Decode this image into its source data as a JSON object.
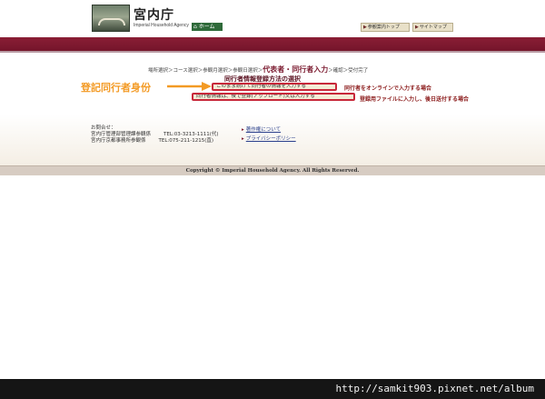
{
  "header": {
    "logo_title": "宮内庁",
    "logo_subtitle": "Imperial Household Agency",
    "home_label": "ホーム",
    "nav_buttons": [
      "参観案内トップ",
      "サイトマップ"
    ]
  },
  "colors": {
    "band": "#7e1a31",
    "accent_red": "#c8283a",
    "annotation_orange": "#f39a24",
    "home_green": "#2f6a3a"
  },
  "steps": {
    "before": "場所選択＞コース選択＞参観月選択＞参観日選択＞",
    "current": "代表者・同行者入力",
    "after": "＞確認＞受付完了"
  },
  "section_title": "同行者情報登録方法の選択",
  "options": [
    {
      "label": "このまま続けて同行者の情報を入力する",
      "description": "同行者をオンラインで入力する場合"
    },
    {
      "label": "同行者情報は、後で登録(アップロード)又は入力する",
      "description": "登録用ファイルに入力し、後日送付する場合"
    }
  ],
  "annotation": {
    "label": "登記同行者身份"
  },
  "contact": {
    "heading": "お問合せ：",
    "rows": [
      {
        "name": "宮内庁管理部管理課参観係",
        "tel": "TEL:03-3213-1111(代)"
      },
      {
        "name": "宮内庁京都事務所参観係",
        "tel": "TEL:075-211-1215(直)"
      }
    ]
  },
  "footer_links": [
    "著作権について",
    "プライバシーポリシー"
  ],
  "copyright": "Copyright © Imperial Household Agency. All Rights Reserved.",
  "watermark": "http://samkit903.pixnet.net/album"
}
